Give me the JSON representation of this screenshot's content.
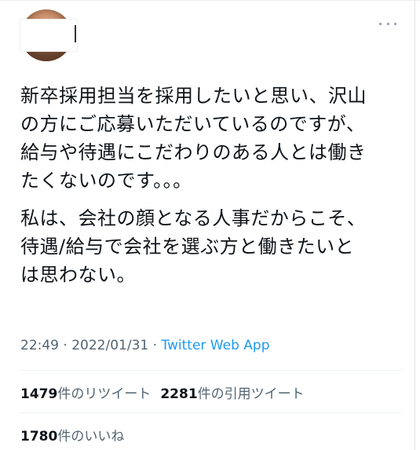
{
  "tweet": {
    "paragraphs": [
      [
        "新卒採用担当を採用したいと思い、沢山",
        "の方にご応募いただいているのですが、",
        "給与や待遇にこだわりのある人とは働き",
        "たくないのです。。。"
      ],
      [
        "私は、会社の顔となる人事だからこそ、",
        "待遇/給与で会社を選ぶ方と働きたいと",
        "は思わない。"
      ]
    ],
    "time": "22:49",
    "date": "2022/01/31",
    "separator": "·",
    "source": "Twitter Web App"
  },
  "stats": {
    "retweets": {
      "count": "1479",
      "label": "件のリツイート"
    },
    "quotes": {
      "count": "2281",
      "label": "件の引用ツイート"
    },
    "likes": {
      "count": "1780",
      "label": "件のいいね"
    }
  },
  "icons": {
    "more": "more-horizontal-icon"
  },
  "colors": {
    "text": "#0f1419",
    "secondary": "#536471",
    "link": "#1d9bf0",
    "divider": "#eff3f4"
  }
}
